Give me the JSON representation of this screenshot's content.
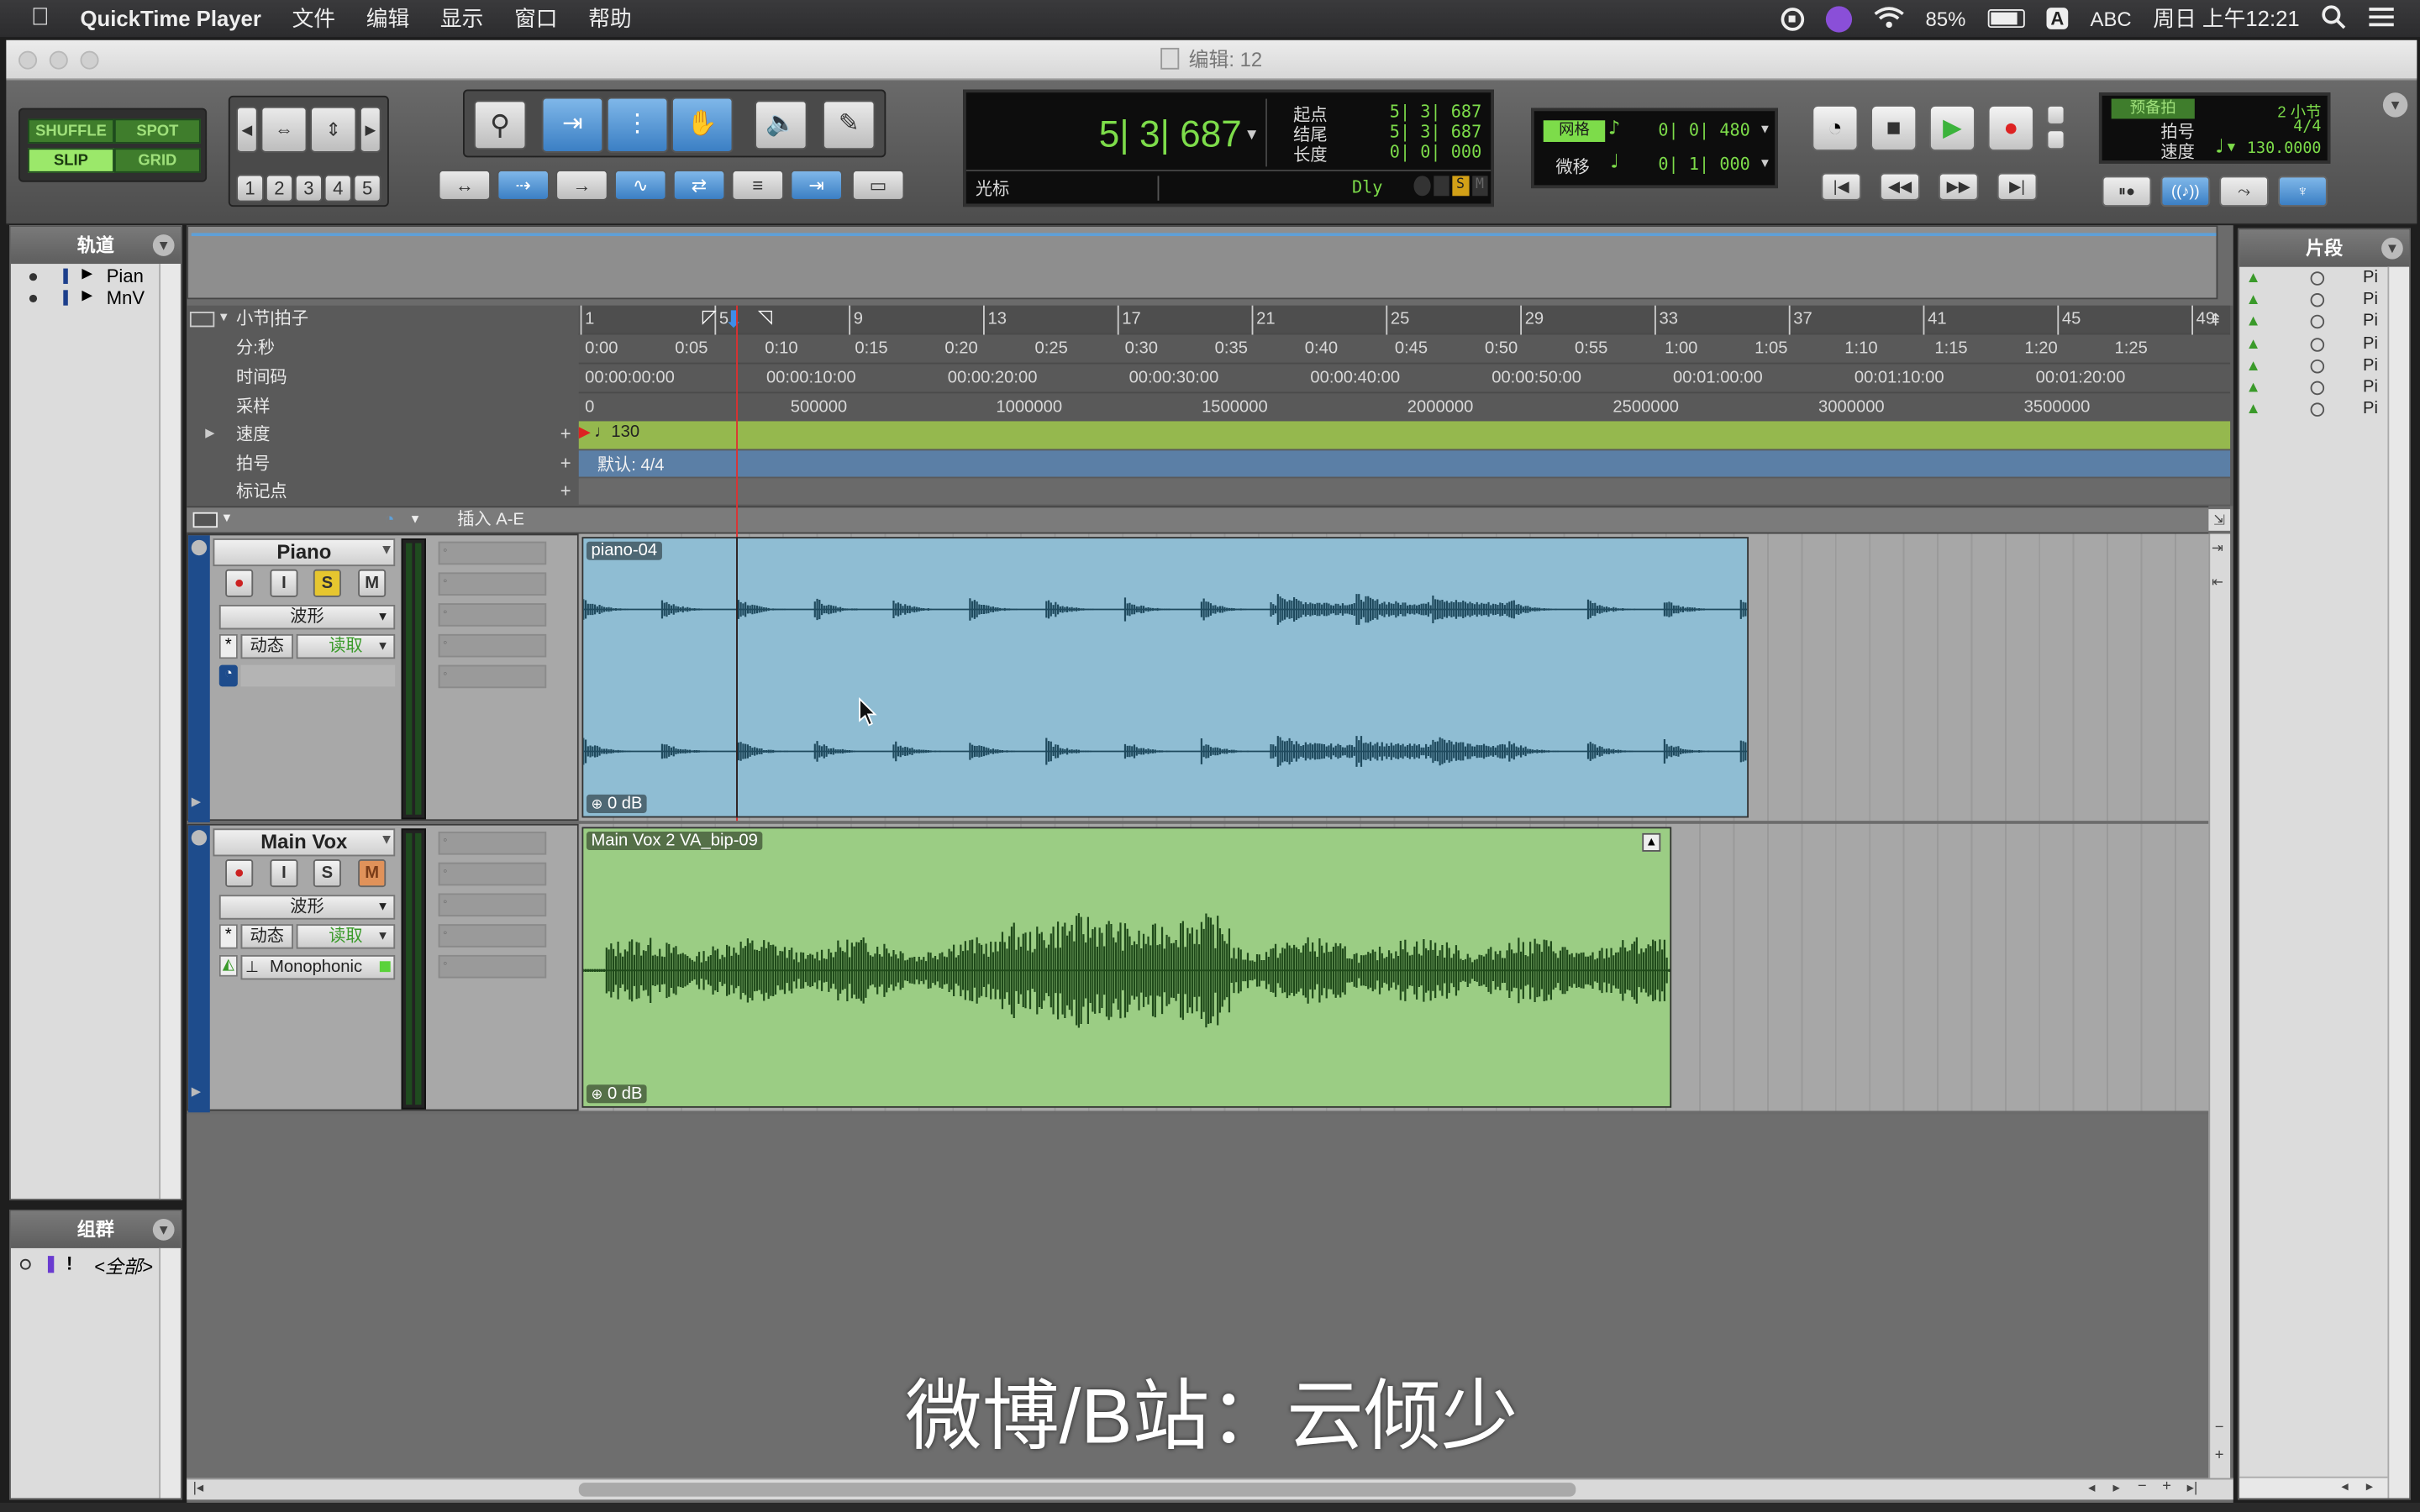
{
  "menubar": {
    "app_name": "QuickTime Player",
    "items": [
      "文件",
      "编辑",
      "显示",
      "窗口",
      "帮助"
    ],
    "battery": "85%",
    "input_method": "ABC",
    "input_badge": "A",
    "datetime": "周日 上午12:21"
  },
  "window": {
    "title": "编辑: 12"
  },
  "toolbar": {
    "modes": {
      "shuffle": "SHUFFLE",
      "spot": "SPOT",
      "slip": "SLIP",
      "grid": "GRID"
    },
    "zoom_presets": [
      "1",
      "2",
      "3",
      "4",
      "5"
    ]
  },
  "counter": {
    "main": "5| 3| 687",
    "start_label": "起点",
    "start_value": "5| 3| 687",
    "end_label": "结尾",
    "end_value": "5| 3| 687",
    "length_label": "长度",
    "length_value": "0| 0| 000",
    "cursor_label": "光标",
    "dly_label": "Dly"
  },
  "grid_nudge": {
    "grid_label": "网格",
    "grid_value": "0| 0| 480",
    "nudge_label": "微移",
    "nudge_value": "0| 1| 000"
  },
  "midi": {
    "preroll_label": "预备拍",
    "preroll_value": "2 小节",
    "meter_label": "拍号",
    "meter_value": "4/4",
    "tempo_label": "速度",
    "tempo_value": "130.0000"
  },
  "tracks_panel": {
    "title": "轨道",
    "tracks": [
      "Pian",
      "MnV"
    ]
  },
  "groups_panel": {
    "title": "组群",
    "group_all": "<全部>",
    "flag": "!"
  },
  "regions_panel": {
    "title": "片段",
    "items": [
      "Pi",
      "Pi",
      "Pi",
      "Pi",
      "Pi",
      "Pi",
      "Pi"
    ]
  },
  "rulers": {
    "bars_label": "小节|拍子",
    "minsec_label": "分:秒",
    "timecode_label": "时间码",
    "samples_label": "采样",
    "tempo_label": "速度",
    "meter_label": "拍号",
    "markers_label": "标记点",
    "bars": [
      "1",
      "5",
      "9",
      "13",
      "17",
      "21",
      "25",
      "29",
      "33",
      "37",
      "41",
      "45",
      "49"
    ],
    "minsec": [
      "0:00",
      "0:05",
      "0:10",
      "0:15",
      "0:20",
      "0:25",
      "0:30",
      "0:35",
      "0:40",
      "0:45",
      "0:50",
      "0:55",
      "1:00",
      "1:05",
      "1:10",
      "1:15",
      "1:20",
      "1:25"
    ],
    "timecode": [
      "00:00:00:00",
      "00:00:10:00",
      "00:00:20:00",
      "00:00:30:00",
      "00:00:40:00",
      "00:00:50:00",
      "00:01:00:00",
      "00:01:10:00",
      "00:01:20:00"
    ],
    "samples": [
      "0",
      "500000",
      "1000000",
      "1500000",
      "2000000",
      "2500000",
      "3000000",
      "3500000"
    ],
    "tempo_value": "130",
    "meter_value": "默认: 4/4"
  },
  "inserts_header": "插入 A-E",
  "tracks": [
    {
      "name": "Piano",
      "view": "波形",
      "auto_label": "动态",
      "auto_mode": "读取",
      "clip_name": "piano-04",
      "clip_gain": "0 dB",
      "solo_on": true
    },
    {
      "name": "Main Vox",
      "view": "波形",
      "auto_label": "动态",
      "auto_mode": "读取",
      "plugin": "Monophonic",
      "clip_name": "Main Vox 2 VA_bip-09",
      "clip_gain": "0 dB",
      "mute_on": true
    }
  ],
  "track_buttons": {
    "rec": "●",
    "input": "I",
    "solo": "S",
    "mute": "M"
  },
  "watermark": "微博/B站：云倾少",
  "colors": {
    "piano_clip": "#8fbdd3",
    "vox_clip": "#9bcd84",
    "lcd_text": "#7ddc4a",
    "tempo_ruler": "#95b84e",
    "meter_ruler": "#5b7fa6"
  }
}
